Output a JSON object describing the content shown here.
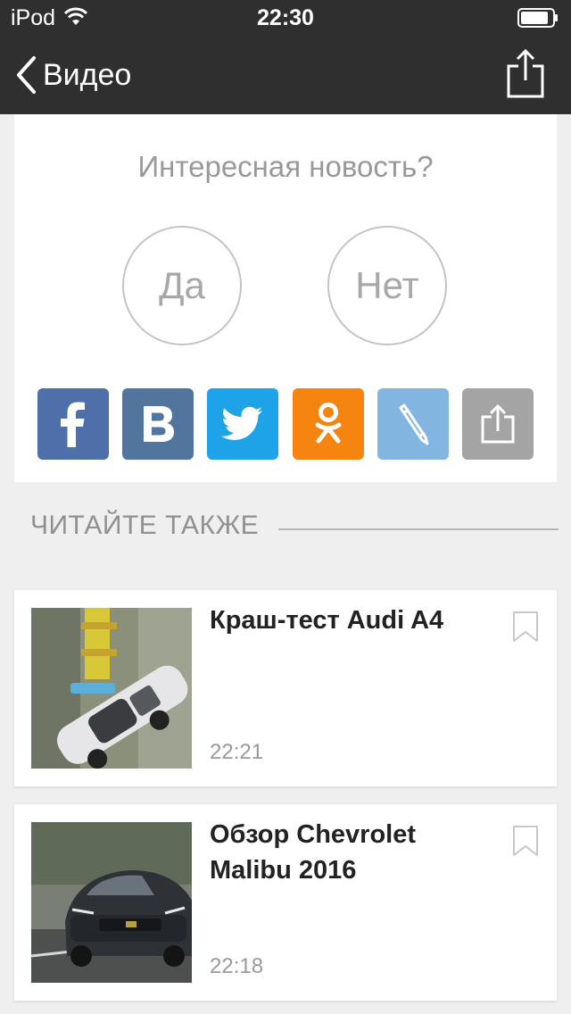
{
  "status_bar": {
    "carrier": "iPod",
    "time": "22:30"
  },
  "nav": {
    "back_label": "Видео"
  },
  "poll": {
    "question": "Интересная новость?",
    "yes_label": "Да",
    "no_label": "Нет"
  },
  "share_buttons": [
    {
      "name": "facebook",
      "color": "#4f6faa",
      "icon": "facebook-icon"
    },
    {
      "name": "vkontakte",
      "color": "#52759d",
      "icon": "vk-icon"
    },
    {
      "name": "twitter",
      "color": "#1fa3e8",
      "icon": "twitter-icon"
    },
    {
      "name": "odnoklassniki",
      "color": "#f58411",
      "icon": "odnoklassniki-icon"
    },
    {
      "name": "edit",
      "color": "#82b5e0",
      "icon": "pencil-icon"
    },
    {
      "name": "share",
      "color": "#a4a4a4",
      "icon": "share-icon"
    }
  ],
  "read_also": {
    "heading": "ЧИТАЙТЕ ТАКЖЕ",
    "articles": [
      {
        "title": "Краш-тест Audi A4",
        "time": "22:21",
        "thumb_icon": "crash-test-thumbnail"
      },
      {
        "title": "Обзор Chevrolet Malibu 2016",
        "time": "22:18",
        "thumb_icon": "car-review-thumbnail"
      }
    ]
  }
}
